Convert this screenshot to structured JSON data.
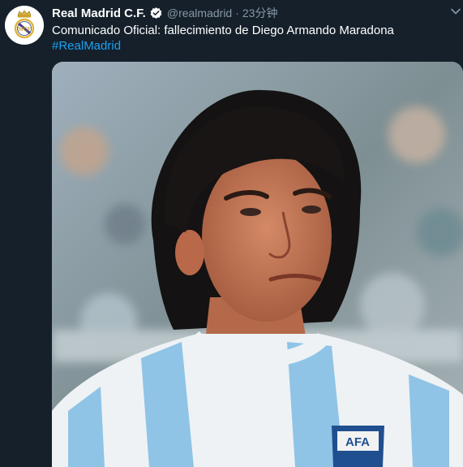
{
  "tweet": {
    "display_name": "Real Madrid C.F.",
    "handle": "@realmadrid",
    "separator": "·",
    "time": "23分钟",
    "text": "Comunicado Oficial: fallecimiento de Diego Armando Maradona",
    "hashtag": "#RealMadrid"
  },
  "media": {
    "badge_text": "AFA"
  },
  "icons": {
    "avatar": "real-madrid-crest",
    "verified": "verified-badge-icon",
    "menu": "chevron-down-icon"
  },
  "colors": {
    "background": "#15202b",
    "primary_text": "#ffffff",
    "secondary_text": "#8899a6",
    "link": "#1da1f2"
  }
}
